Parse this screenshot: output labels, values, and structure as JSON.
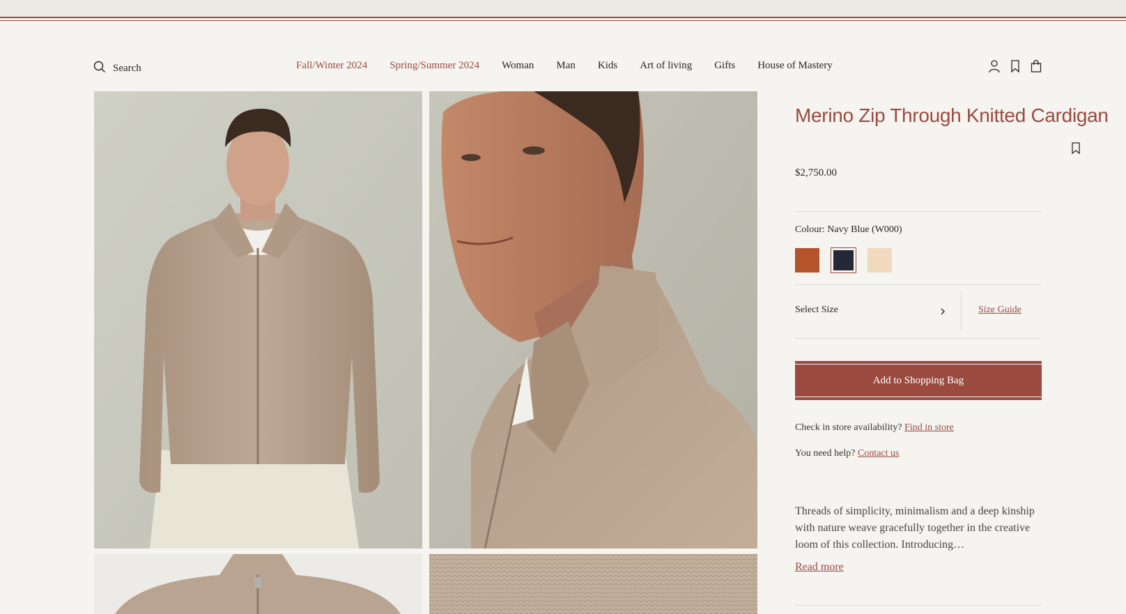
{
  "header": {
    "search_label": "Search",
    "nav": [
      {
        "label": "Fall/Winter 2024",
        "accent": true
      },
      {
        "label": "Spring/Summer 2024",
        "accent": true
      },
      {
        "label": "Woman",
        "accent": false
      },
      {
        "label": "Man",
        "accent": false
      },
      {
        "label": "Kids",
        "accent": false
      },
      {
        "label": "Art of living",
        "accent": false
      },
      {
        "label": "Gifts",
        "accent": false
      },
      {
        "label": "House of Mastery",
        "accent": false
      }
    ],
    "icons": [
      "account-icon",
      "wishlist-icon",
      "shopping-bag-icon"
    ]
  },
  "product": {
    "title": "Merino Zip Through Knitted Cardigan",
    "price": "$2,750.00",
    "colour_label": "Colour:",
    "colour_value": "Navy Blue (W000)",
    "swatches": [
      {
        "name": "rust",
        "color": "#b5532a"
      },
      {
        "name": "navy",
        "color": "#252836",
        "selected": true
      },
      {
        "name": "sand",
        "color": "#f0d9bd"
      }
    ],
    "select_size": "Select Size",
    "size_guide": "Size Guide",
    "add_to_bag": "Add to Shopping Bag",
    "store_prompt": "Check in store availability?",
    "store_link": "Find in store",
    "help_prompt": "You need help?",
    "help_link": "Contact us",
    "description": "Threads of simplicity, minimalism and a deep kinship with nature weave gracefully together in the creative loom of this collection. Introducing…",
    "read_more": "Read more"
  },
  "colors": {
    "accent": "#9a4a3f",
    "background": "#f6f4f0",
    "cardigan": "#b8a490"
  }
}
